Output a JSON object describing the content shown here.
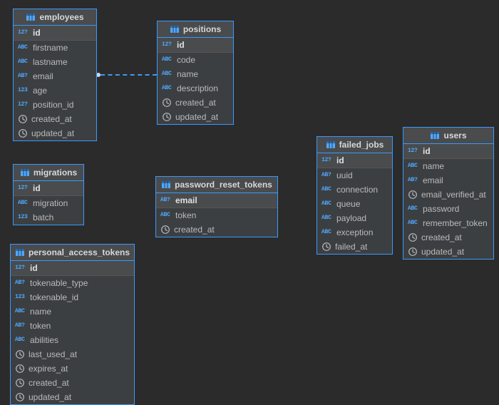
{
  "tables": {
    "employees": {
      "title": "employees",
      "cols": {
        "id": "id",
        "firstname": "firstname",
        "lastname": "lastname",
        "email": "email",
        "age": "age",
        "position_id": "position_id",
        "created_at": "created_at",
        "updated_at": "updated_at"
      }
    },
    "positions": {
      "title": "positions",
      "cols": {
        "id": "id",
        "code": "code",
        "name": "name",
        "description": "description",
        "created_at": "created_at",
        "updated_at": "updated_at"
      }
    },
    "migrations": {
      "title": "migrations",
      "cols": {
        "id": "id",
        "migration": "migration",
        "batch": "batch"
      }
    },
    "password_reset_tokens": {
      "title": "password_reset_tokens",
      "cols": {
        "email": "email",
        "token": "token",
        "created_at": "created_at"
      }
    },
    "failed_jobs": {
      "title": "failed_jobs",
      "cols": {
        "id": "id",
        "uuid": "uuid",
        "connection": "connection",
        "queue": "queue",
        "payload": "payload",
        "exception": "exception",
        "failed_at": "failed_at"
      }
    },
    "users": {
      "title": "users",
      "cols": {
        "id": "id",
        "name": "name",
        "email": "email",
        "email_verified_at": "email_verified_at",
        "password": "password",
        "remember_token": "remember_token",
        "created_at": "created_at",
        "updated_at": "updated_at"
      }
    },
    "personal_access_tokens": {
      "title": "personal_access_tokens",
      "cols": {
        "id": "id",
        "tokenable_type": "tokenable_type",
        "tokenable_id": "tokenable_id",
        "name": "name",
        "token": "token",
        "abilities": "abilities",
        "last_used_at": "last_used_at",
        "expires_at": "expires_at",
        "created_at": "created_at",
        "updated_at": "updated_at"
      }
    }
  },
  "relationships": [
    {
      "from_table": "employees",
      "from_column": "position_id",
      "to_table": "positions",
      "to_column": "id"
    }
  ],
  "type_labels": {
    "int_pk": "12?",
    "int": "123",
    "text": "ABC",
    "text_idx": "AB?"
  }
}
